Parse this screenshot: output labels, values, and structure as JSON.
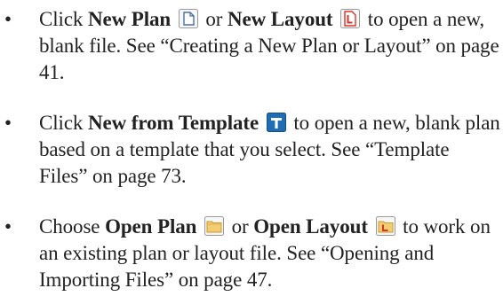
{
  "bullets": [
    {
      "bullet": "•",
      "pre1": "Click ",
      "cmd1": "New Plan",
      "icon1": "new-plan-icon",
      "mid": " or ",
      "cmd2": "New Layout",
      "icon2": "new-layout-icon",
      "post": " to open a new, blank file. See “Creating a New Plan or Layout” on page 41."
    },
    {
      "bullet": "•",
      "pre1": "Click ",
      "cmd1": "New from Template",
      "icon1": "new-from-template-icon",
      "post": " to open a new, blank plan based on a template that you select. See “Template Files” on page 73."
    },
    {
      "bullet": "•",
      "pre1": "Choose ",
      "cmd1": "Open Plan",
      "icon1": "open-plan-icon",
      "mid": " or ",
      "cmd2": "Open Layout",
      "icon2": "open-layout-icon",
      "post": " to work on an existing plan or layout file. See “Opening and Importing Files” on page 47."
    }
  ],
  "colors": {
    "text": "#222222",
    "template_icon_blue": "#1f6db5",
    "folder_yellow": "#f3cd72",
    "layout_red": "#d9342b"
  }
}
